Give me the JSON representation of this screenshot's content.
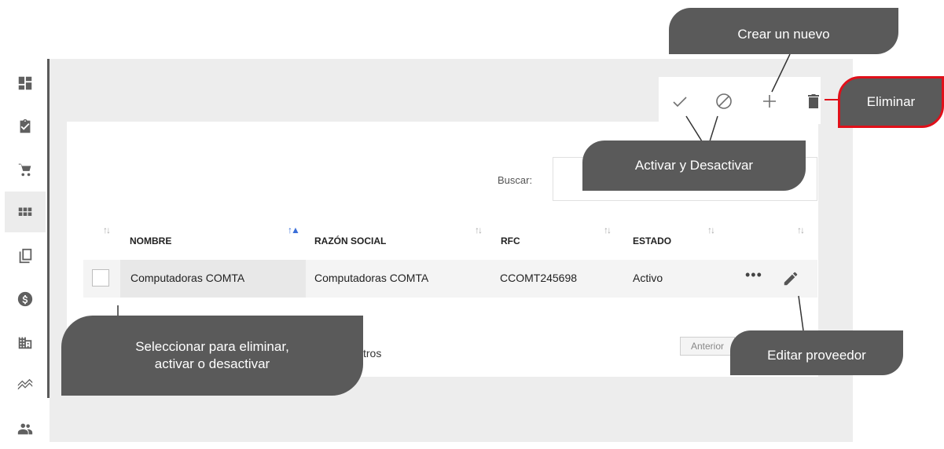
{
  "sidebar": {
    "items": [
      {
        "icon": "dashboard-icon"
      },
      {
        "icon": "clipboard-check-icon"
      },
      {
        "icon": "shopping-cart-icon"
      },
      {
        "icon": "grid-view-icon"
      },
      {
        "icon": "copy-icon"
      },
      {
        "icon": "dollar-icon"
      },
      {
        "icon": "building-icon"
      },
      {
        "icon": "trending-icon"
      },
      {
        "icon": "users-icon"
      }
    ],
    "active_index": 3
  },
  "toolbar": {
    "activate_icon": "check-icon",
    "deactivate_icon": "block-icon",
    "add_icon": "plus-icon",
    "delete_icon": "trash-icon"
  },
  "search": {
    "label": "Buscar:",
    "value": ""
  },
  "table": {
    "columns": [
      "NOMBRE",
      "RAZÓN SOCIAL",
      "RFC",
      "ESTADO"
    ],
    "rows": [
      {
        "nombre": "Computadoras COMTA",
        "razon_social": "Computadoras COMTA",
        "rfc": "CCOMT245698",
        "estado": "Activo",
        "more": "•••"
      }
    ]
  },
  "footer": {
    "records_text": "stros",
    "prev_label": "Anterior"
  },
  "callouts": {
    "crear": "Crear un nuevo",
    "eliminar": "Eliminar",
    "activar": "Activar y Desactivar",
    "seleccionar_line1": "Seleccionar para eliminar,",
    "seleccionar_line2": "activar o desactivar",
    "editar": "Editar proveedor"
  },
  "colors": {
    "callout_bg": "#5a5a5a",
    "highlight_border": "#e0101a",
    "sort_active": "#3b6fd8",
    "panel_bg": "#ededed"
  }
}
